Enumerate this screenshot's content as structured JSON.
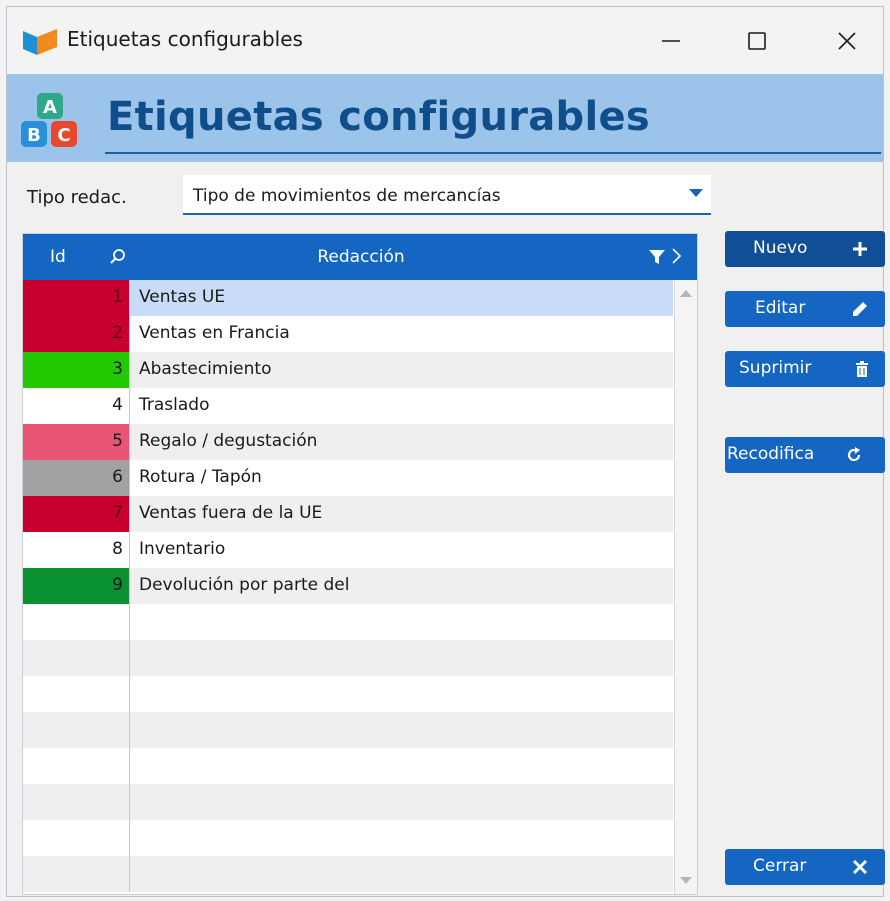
{
  "window": {
    "title": "Etiquetas configurables",
    "controls": {
      "minimize": "minimize-icon",
      "maximize": "maximize-icon",
      "close": "close-icon"
    }
  },
  "banner": {
    "title": "Etiquetas configurables",
    "icon": "abc-blocks-icon"
  },
  "filter": {
    "label": "Tipo redac.",
    "value": "Tipo de movimientos de mercancías"
  },
  "grid": {
    "columns": {
      "id": "Id",
      "redaccion": "Redacción"
    },
    "rows": [
      {
        "id": "1",
        "label": "Ventas UE",
        "color": "#c8002f"
      },
      {
        "id": "2",
        "label": "Ventas en Francia",
        "color": "#c8002f"
      },
      {
        "id": "3",
        "label": "Abastecimiento",
        "color": "#22c800"
      },
      {
        "id": "4",
        "label": "Traslado",
        "color": "#ffffff"
      },
      {
        "id": "5",
        "label": "Regalo / degustación",
        "color": "#e85476"
      },
      {
        "id": "6",
        "label": "Rotura / Tapón",
        "color": "#a2a2a2"
      },
      {
        "id": "7",
        "label": "Ventas fuera de la UE",
        "color": "#c8002f"
      },
      {
        "id": "8",
        "label": "Inventario",
        "color": "#ffffff"
      },
      {
        "id": "9",
        "label": "Devolución por parte del",
        "color": "#0a9232"
      }
    ],
    "selected_row": "1"
  },
  "buttons": {
    "nuevo": "Nuevo",
    "editar": "Editar",
    "suprimir": "Suprimir",
    "recodifica": "Recodifica",
    "cerrar": "Cerrar"
  },
  "colors": {
    "accent": "#1466c2",
    "banner": "#9cc3ea",
    "banner_title": "#0f4e8a"
  }
}
